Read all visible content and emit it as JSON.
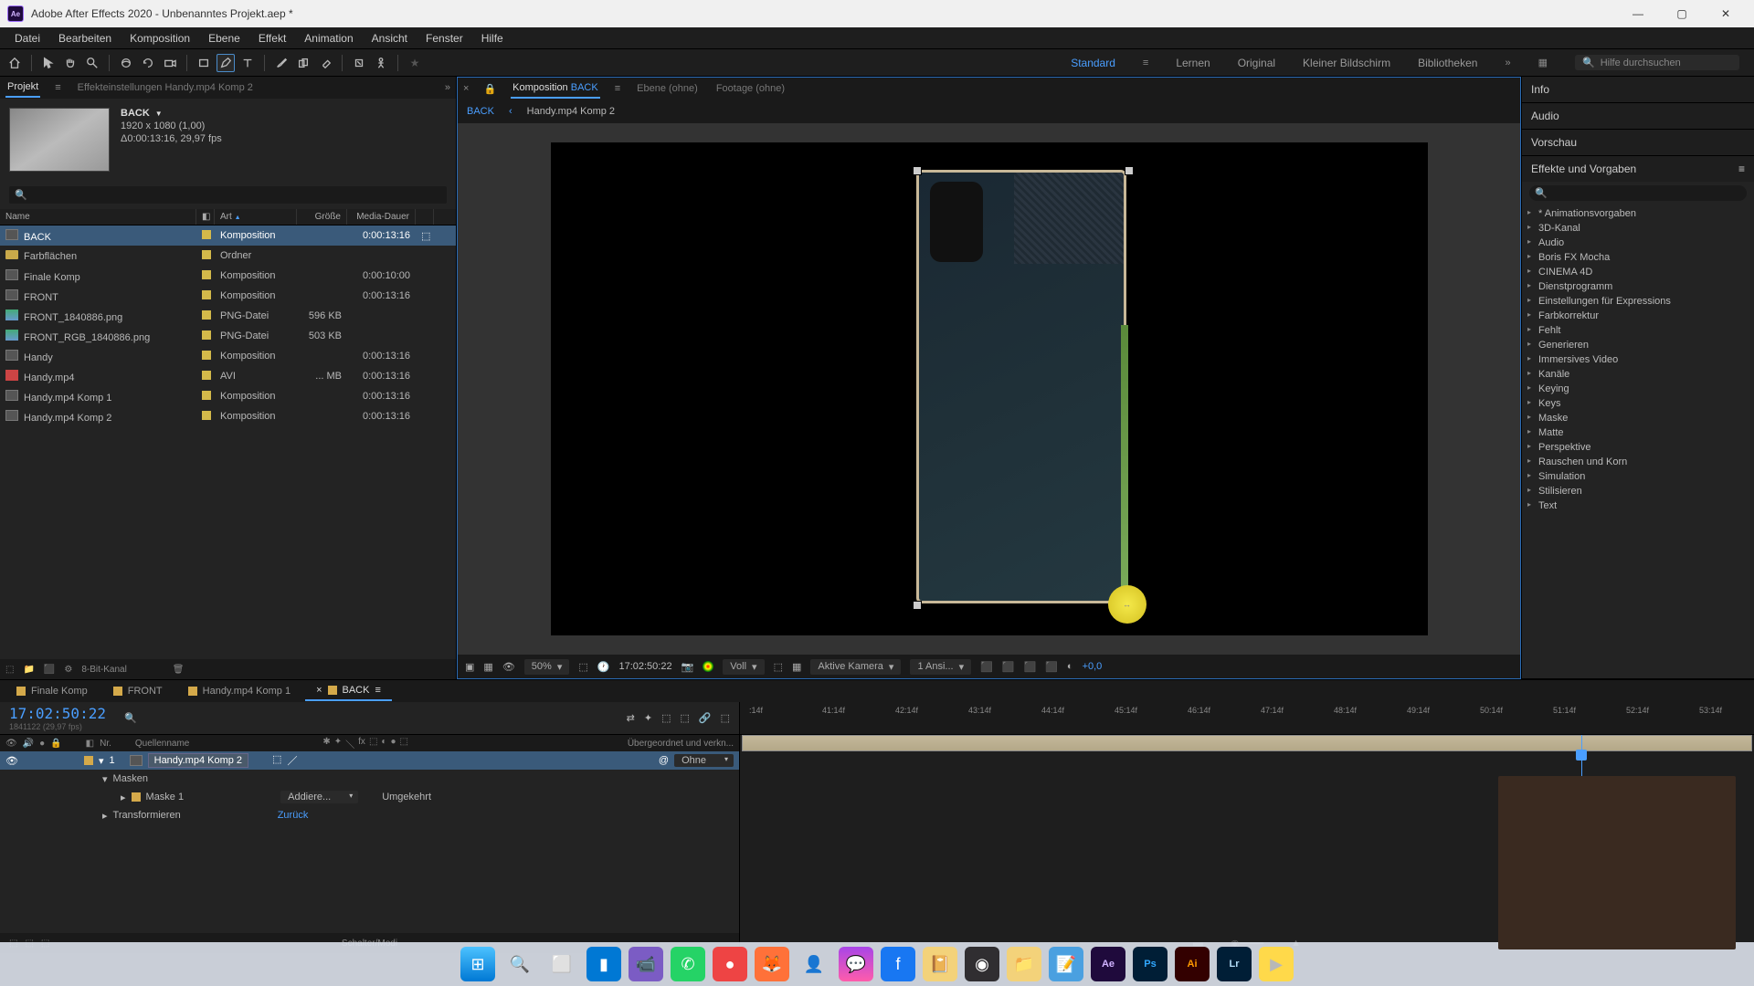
{
  "title": "Adobe After Effects 2020 - Unbenanntes Projekt.aep *",
  "menu": [
    "Datei",
    "Bearbeiten",
    "Komposition",
    "Ebene",
    "Effekt",
    "Animation",
    "Ansicht",
    "Fenster",
    "Hilfe"
  ],
  "workspaces": {
    "active": "Standard",
    "items": [
      "Standard",
      "Lernen",
      "Original",
      "Kleiner Bildschirm",
      "Bibliotheken"
    ]
  },
  "search_placeholder": "Hilfe durchsuchen",
  "left": {
    "tabs": {
      "project": "Projekt",
      "effect_controls": "Effekteinstellungen Handy.mp4 Komp 2"
    },
    "thumb_name": "BACK",
    "thumb_res": "1920 x 1080 (1,00)",
    "thumb_dur": "Δ0:00:13:16, 29,97 fps",
    "columns": {
      "name": "Name",
      "type": "Art",
      "size": "Größe",
      "dur": "Media-Dauer"
    },
    "items": [
      {
        "name": "BACK",
        "type": "Komposition",
        "size": "",
        "dur": "0:00:13:16",
        "icon": "comp",
        "selected": true
      },
      {
        "name": "Farbflächen",
        "type": "Ordner",
        "size": "",
        "dur": "",
        "icon": "folder"
      },
      {
        "name": "Finale Komp",
        "type": "Komposition",
        "size": "",
        "dur": "0:00:10:00",
        "icon": "comp"
      },
      {
        "name": "FRONT",
        "type": "Komposition",
        "size": "",
        "dur": "0:00:13:16",
        "icon": "comp"
      },
      {
        "name": "FRONT_1840886.png",
        "type": "PNG-Datei",
        "size": "596 KB",
        "dur": "",
        "icon": "png"
      },
      {
        "name": "FRONT_RGB_1840886.png",
        "type": "PNG-Datei",
        "size": "503 KB",
        "dur": "",
        "icon": "png"
      },
      {
        "name": "Handy",
        "type": "Komposition",
        "size": "",
        "dur": "0:00:13:16",
        "icon": "comp"
      },
      {
        "name": "Handy.mp4",
        "type": "AVI",
        "size": "... MB",
        "dur": "0:00:13:16",
        "icon": "avi"
      },
      {
        "name": "Handy.mp4 Komp 1",
        "type": "Komposition",
        "size": "",
        "dur": "0:00:13:16",
        "icon": "comp"
      },
      {
        "name": "Handy.mp4 Komp 2",
        "type": "Komposition",
        "size": "",
        "dur": "0:00:13:16",
        "icon": "comp"
      }
    ],
    "footer_bpc": "8-Bit-Kanal"
  },
  "viewer": {
    "tabs": {
      "comp_prefix": "Komposition",
      "comp_name": "BACK",
      "layer": "Ebene (ohne)",
      "footage": "Footage (ohne)"
    },
    "crumb_active": "BACK",
    "crumb_next": "Handy.mp4 Komp 2",
    "zoom": "50%",
    "timecode": "17:02:50:22",
    "resolution": "Voll",
    "camera": "Aktive Kamera",
    "views": "1 Ansi...",
    "exposure": "+0,0"
  },
  "right": {
    "info": "Info",
    "audio": "Audio",
    "preview": "Vorschau",
    "effects_title": "Effekte und Vorgaben",
    "categories": [
      "* Animationsvorgaben",
      "3D-Kanal",
      "Audio",
      "Boris FX Mocha",
      "CINEMA 4D",
      "Dienstprogramm",
      "Einstellungen für Expressions",
      "Farbkorrektur",
      "Fehlt",
      "Generieren",
      "Immersives Video",
      "Kanäle",
      "Keying",
      "Keys",
      "Maske",
      "Matte",
      "Perspektive",
      "Rauschen und Korn",
      "Simulation",
      "Stilisieren",
      "Text"
    ]
  },
  "timeline": {
    "tabs": [
      "Finale Komp",
      "FRONT",
      "Handy.mp4 Komp 1",
      "BACK"
    ],
    "active_tab": 3,
    "timecode": "17:02:50:22",
    "frames": "1841122 (29,97 fps)",
    "col_nr": "Nr.",
    "col_source": "Quellenname",
    "col_parent": "Übergeordnet und verkn...",
    "ticks": [
      ":14f",
      "41:14f",
      "42:14f",
      "43:14f",
      "44:14f",
      "45:14f",
      "46:14f",
      "47:14f",
      "48:14f",
      "49:14f",
      "50:14f",
      "51:14f",
      "52:14f",
      "53:14f"
    ],
    "layer": {
      "nr": "1",
      "name": "Handy.mp4 Komp 2",
      "parent": "Ohne",
      "masks_label": "Masken",
      "mask1": "Maske 1",
      "mask_mode": "Addiere...",
      "inverted": "Umgekehrt",
      "transform_label": "Transformieren",
      "transform_reset": "Zurück"
    },
    "footer": "Schalter/Modi"
  }
}
